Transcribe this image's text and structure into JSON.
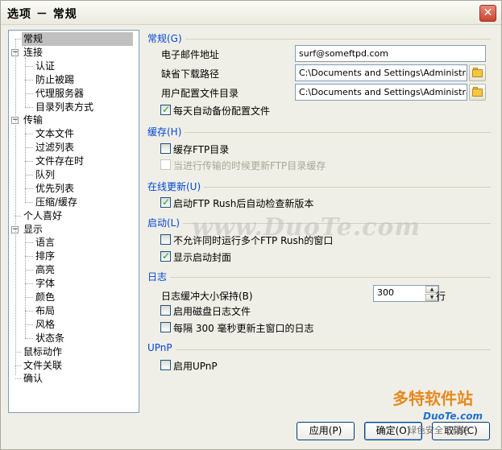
{
  "window": {
    "title": "选项 － 常规",
    "close_glyph": "✕"
  },
  "tree": {
    "items": [
      {
        "label": "常规",
        "selected": true
      },
      {
        "label": "连接",
        "toggle": "−"
      },
      {
        "label": "认证"
      },
      {
        "label": "防止被踢"
      },
      {
        "label": "代理服务器"
      },
      {
        "label": "目录列表方式"
      },
      {
        "label": "传输",
        "toggle": "−"
      },
      {
        "label": "文本文件"
      },
      {
        "label": "过滤列表"
      },
      {
        "label": "文件存在时"
      },
      {
        "label": "队列"
      },
      {
        "label": "优先列表"
      },
      {
        "label": "压缩/缓存"
      },
      {
        "label": "个人喜好"
      },
      {
        "label": "显示",
        "toggle": "−"
      },
      {
        "label": "语言"
      },
      {
        "label": "排序"
      },
      {
        "label": "高亮"
      },
      {
        "label": "字体"
      },
      {
        "label": "颜色"
      },
      {
        "label": "布局"
      },
      {
        "label": "风格"
      },
      {
        "label": "状态条"
      },
      {
        "label": "鼠标动作"
      },
      {
        "label": "文件关联"
      },
      {
        "label": "确认"
      }
    ]
  },
  "general": {
    "title": "常规(G)",
    "email_label": "电子邮件地址",
    "email_value": "surf@someftpd.com",
    "download_label": "缺省下载路径",
    "download_value": "C:\\Documents and Settings\\Administrator\\My",
    "profile_label": "用户配置文件目录",
    "profile_value": "C:\\Documents and Settings\\Administrator\\Ap",
    "daily_backup_label": "每天自动备份配置文件",
    "daily_backup_checked": true
  },
  "cache": {
    "title": "缓存(H)",
    "cache_ftp_label": "缓存FTP目录",
    "cache_ftp_checked": false,
    "update_cache_label": "当进行传输的时候更新FTP目录缓存",
    "update_cache_checked": false
  },
  "online_update": {
    "title": "在线更新(U)",
    "auto_check_label": "启动FTP Rush后自动检查新版本",
    "auto_check_checked": true
  },
  "startup": {
    "title": "启动(L)",
    "no_multi_label": "不允许同时运行多个FTP Rush的窗口",
    "no_multi_checked": false,
    "splash_label": "显示启动封面",
    "splash_checked": true
  },
  "log": {
    "title": "日志",
    "buffer_label": "日志缓冲大小保持(B)",
    "buffer_value": "300",
    "buffer_unit": "行",
    "disk_log_label": "启用磁盘日志文件",
    "disk_log_checked": false,
    "refresh_label": "每隔 300 毫秒更新主窗口的日志",
    "refresh_checked": false
  },
  "upnp": {
    "title": "UPnP",
    "enable_label": "启用UPnP",
    "enable_checked": false
  },
  "buttons": {
    "apply": "应用(P)",
    "ok": "确定(O)",
    "cancel": "取消(C)"
  },
  "watermarks": {
    "center": "www.DuoTe.com",
    "logo": "多特软件站",
    "logo_url": "DuoTe.com",
    "bottom": "绿色安全下载站"
  },
  "colors": {
    "section_title": "#0046d5",
    "check_mark": "#21a121",
    "watermark_orange": "#e58a1f"
  }
}
